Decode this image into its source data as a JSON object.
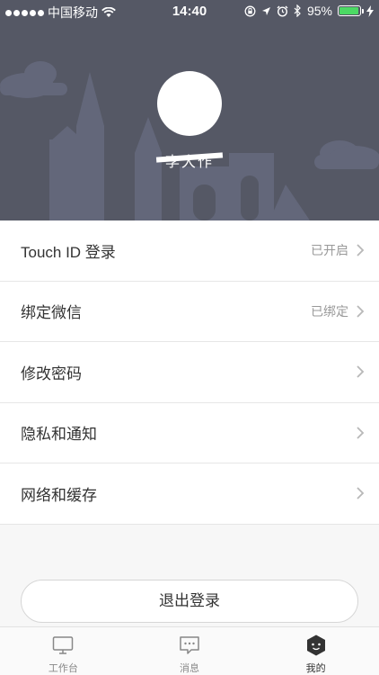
{
  "status_bar": {
    "carrier": "中国移动",
    "time": "14:40",
    "battery": "95%",
    "battery_level": 0.95,
    "icons": [
      "signal-dots-icon",
      "wifi-icon",
      "orientation-lock-icon",
      "location-icon",
      "alarm-icon",
      "bluetooth-icon",
      "battery-icon",
      "charging-icon"
    ]
  },
  "profile": {
    "username": "李大作"
  },
  "menu": [
    {
      "label": "Touch ID 登录",
      "value": "已开启",
      "icon": "chevron-right-icon"
    },
    {
      "label": "绑定微信",
      "value": "已绑定",
      "icon": "chevron-right-icon"
    },
    {
      "label": "修改密码",
      "value": "",
      "icon": "chevron-right-icon"
    },
    {
      "label": "隐私和通知",
      "value": "",
      "icon": "chevron-right-icon"
    },
    {
      "label": "网络和缓存",
      "value": "",
      "icon": "chevron-right-icon"
    }
  ],
  "logout_label": "退出登录",
  "tabs": [
    {
      "label": "工作台",
      "icon": "monitor-icon",
      "active": false
    },
    {
      "label": "消息",
      "icon": "chat-bubble-icon",
      "active": false
    },
    {
      "label": "我的",
      "icon": "profile-face-icon",
      "active": true
    }
  ],
  "colors": {
    "header_bg": "#555865",
    "battery_green": "#4cd964",
    "active_tab": "#333333",
    "inactive_tab": "#888888"
  }
}
